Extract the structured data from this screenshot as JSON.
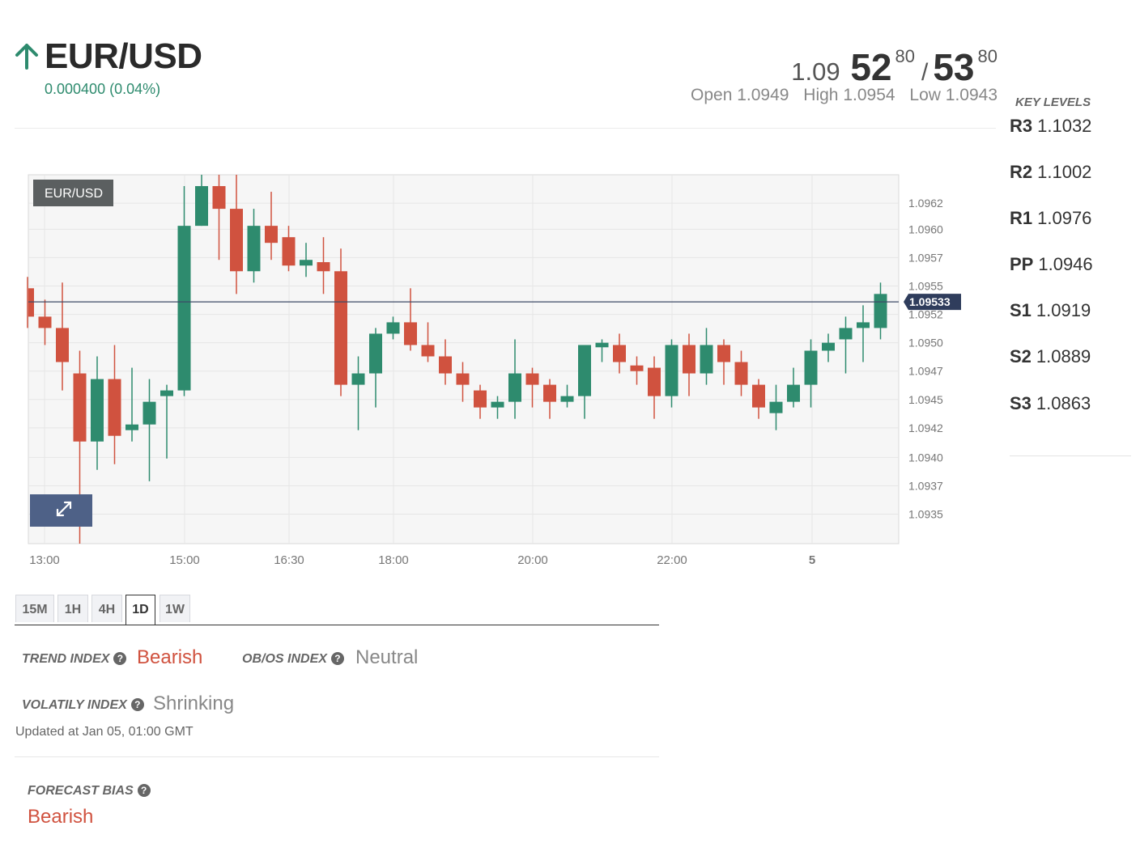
{
  "instrument": {
    "pair": "EUR/USD",
    "change": "0.000400 (0.04%)",
    "direction": "up",
    "trend_color": "#2e8b6e"
  },
  "quote": {
    "bid_prefix": "1.09",
    "bid_main": "52",
    "bid_pip": "80",
    "separator": "/",
    "ask_main": "53",
    "ask_pip": "80"
  },
  "ohl": {
    "open": "Open 1.0949",
    "high": "High 1.0954",
    "low": "Low 1.0943"
  },
  "key_levels": {
    "title": "KEY LEVELS",
    "items": [
      {
        "name": "R3",
        "value": "1.1032"
      },
      {
        "name": "R2",
        "value": "1.1002"
      },
      {
        "name": "R1",
        "value": "1.0976"
      },
      {
        "name": "PP",
        "value": "1.0946"
      },
      {
        "name": "S1",
        "value": "1.0919"
      },
      {
        "name": "S2",
        "value": "1.0889"
      },
      {
        "name": "S3",
        "value": "1.0863"
      }
    ]
  },
  "chart": {
    "symbol_label": "EUR/USD",
    "current_price_label": "1.09533",
    "up_color": "#2e8b6e",
    "down_color": "#d0523f",
    "expand_icon": "expand-arrows-icon"
  },
  "chart_data": {
    "type": "candlestick",
    "symbol": "EUR/USD",
    "current_price": 1.09533,
    "y_ticks": [
      "1.0962",
      "1.0960",
      "1.0957",
      "1.0955",
      "1.0952",
      "1.0950",
      "1.0947",
      "1.0945",
      "1.0942",
      "1.0940",
      "1.0937",
      "1.0935"
    ],
    "x_ticks": [
      "13:00",
      "15:00",
      "16:30",
      "18:00",
      "20:00",
      "22:00",
      "5"
    ],
    "ylim": [
      1.0932,
      1.09645
    ],
    "candles": [
      {
        "o": 1.09545,
        "h": 1.09555,
        "l": 1.0951,
        "c": 1.0952
      },
      {
        "o": 1.0952,
        "h": 1.09535,
        "l": 1.09495,
        "c": 1.0951
      },
      {
        "o": 1.0951,
        "h": 1.0955,
        "l": 1.09455,
        "c": 1.0948
      },
      {
        "o": 1.0947,
        "h": 1.0949,
        "l": 1.0932,
        "c": 1.0941
      },
      {
        "o": 1.0941,
        "h": 1.09485,
        "l": 1.09385,
        "c": 1.09465
      },
      {
        "o": 1.09465,
        "h": 1.09495,
        "l": 1.0939,
        "c": 1.09415
      },
      {
        "o": 1.0942,
        "h": 1.09475,
        "l": 1.0941,
        "c": 1.09425
      },
      {
        "o": 1.09425,
        "h": 1.09465,
        "l": 1.09375,
        "c": 1.09445
      },
      {
        "o": 1.0945,
        "h": 1.0946,
        "l": 1.09395,
        "c": 1.09455
      },
      {
        "o": 1.09455,
        "h": 1.09635,
        "l": 1.0945,
        "c": 1.096
      },
      {
        "o": 1.096,
        "h": 1.09645,
        "l": 1.096,
        "c": 1.09635
      },
      {
        "o": 1.09635,
        "h": 1.09645,
        "l": 1.0957,
        "c": 1.09615
      },
      {
        "o": 1.09615,
        "h": 1.09645,
        "l": 1.0954,
        "c": 1.0956
      },
      {
        "o": 1.0956,
        "h": 1.09615,
        "l": 1.0955,
        "c": 1.096
      },
      {
        "o": 1.096,
        "h": 1.0963,
        "l": 1.0957,
        "c": 1.09585
      },
      {
        "o": 1.0959,
        "h": 1.096,
        "l": 1.0956,
        "c": 1.09565
      },
      {
        "o": 1.09565,
        "h": 1.09585,
        "l": 1.09555,
        "c": 1.0957
      },
      {
        "o": 1.09568,
        "h": 1.0959,
        "l": 1.0954,
        "c": 1.0956
      },
      {
        "o": 1.0956,
        "h": 1.0958,
        "l": 1.0945,
        "c": 1.0946
      },
      {
        "o": 1.0946,
        "h": 1.09485,
        "l": 1.0942,
        "c": 1.0947
      },
      {
        "o": 1.0947,
        "h": 1.0951,
        "l": 1.0944,
        "c": 1.09505
      },
      {
        "o": 1.09505,
        "h": 1.0952,
        "l": 1.095,
        "c": 1.09515
      },
      {
        "o": 1.09515,
        "h": 1.09545,
        "l": 1.0949,
        "c": 1.09495
      },
      {
        "o": 1.09495,
        "h": 1.09515,
        "l": 1.0948,
        "c": 1.09485
      },
      {
        "o": 1.09485,
        "h": 1.095,
        "l": 1.0946,
        "c": 1.0947
      },
      {
        "o": 1.0947,
        "h": 1.0948,
        "l": 1.09445,
        "c": 1.0946
      },
      {
        "o": 1.09455,
        "h": 1.0946,
        "l": 1.0943,
        "c": 1.0944
      },
      {
        "o": 1.0944,
        "h": 1.0945,
        "l": 1.0943,
        "c": 1.09445
      },
      {
        "o": 1.09445,
        "h": 1.095,
        "l": 1.0943,
        "c": 1.0947
      },
      {
        "o": 1.0947,
        "h": 1.09475,
        "l": 1.0944,
        "c": 1.0946
      },
      {
        "o": 1.0946,
        "h": 1.09465,
        "l": 1.0943,
        "c": 1.09445
      },
      {
        "o": 1.09445,
        "h": 1.0946,
        "l": 1.0944,
        "c": 1.0945
      },
      {
        "o": 1.0945,
        "h": 1.0949,
        "l": 1.0943,
        "c": 1.09495
      },
      {
        "o": 1.09493,
        "h": 1.095,
        "l": 1.0948,
        "c": 1.09497
      },
      {
        "o": 1.09495,
        "h": 1.09505,
        "l": 1.0947,
        "c": 1.0948
      },
      {
        "o": 1.09477,
        "h": 1.09485,
        "l": 1.0946,
        "c": 1.09472
      },
      {
        "o": 1.09475,
        "h": 1.09485,
        "l": 1.0943,
        "c": 1.0945
      },
      {
        "o": 1.0945,
        "h": 1.095,
        "l": 1.0944,
        "c": 1.09495
      },
      {
        "o": 1.09495,
        "h": 1.09505,
        "l": 1.0945,
        "c": 1.0947
      },
      {
        "o": 1.0947,
        "h": 1.0951,
        "l": 1.0946,
        "c": 1.09495
      },
      {
        "o": 1.09495,
        "h": 1.095,
        "l": 1.0946,
        "c": 1.0948
      },
      {
        "o": 1.0948,
        "h": 1.0949,
        "l": 1.0945,
        "c": 1.0946
      },
      {
        "o": 1.0946,
        "h": 1.09465,
        "l": 1.0943,
        "c": 1.0944
      },
      {
        "o": 1.09435,
        "h": 1.0946,
        "l": 1.0942,
        "c": 1.09445
      },
      {
        "o": 1.09445,
        "h": 1.09475,
        "l": 1.0944,
        "c": 1.0946
      },
      {
        "o": 1.0946,
        "h": 1.095,
        "l": 1.0944,
        "c": 1.0949
      },
      {
        "o": 1.0949,
        "h": 1.09505,
        "l": 1.0948,
        "c": 1.09497
      },
      {
        "o": 1.095,
        "h": 1.0952,
        "l": 1.0947,
        "c": 1.0951
      },
      {
        "o": 1.0951,
        "h": 1.0953,
        "l": 1.0948,
        "c": 1.09515
      },
      {
        "o": 1.0951,
        "h": 1.0955,
        "l": 1.095,
        "c": 1.0954
      }
    ]
  },
  "timeframes": {
    "tabs": [
      "15M",
      "1H",
      "4H",
      "1D",
      "1W"
    ],
    "active": "1D"
  },
  "indexes": {
    "trend_label": "TREND INDEX",
    "trend_value": "Bearish",
    "obos_label": "OB/OS INDEX",
    "obos_value": "Neutral",
    "volatility_label": "VOLATILY INDEX",
    "volatility_value": "Shrinking",
    "help_icon": "question-circle-icon",
    "updated_at": "Updated at Jan 05, 01:00 GMT"
  },
  "forecast": {
    "label": "FORECAST BIAS",
    "value": "Bearish"
  }
}
